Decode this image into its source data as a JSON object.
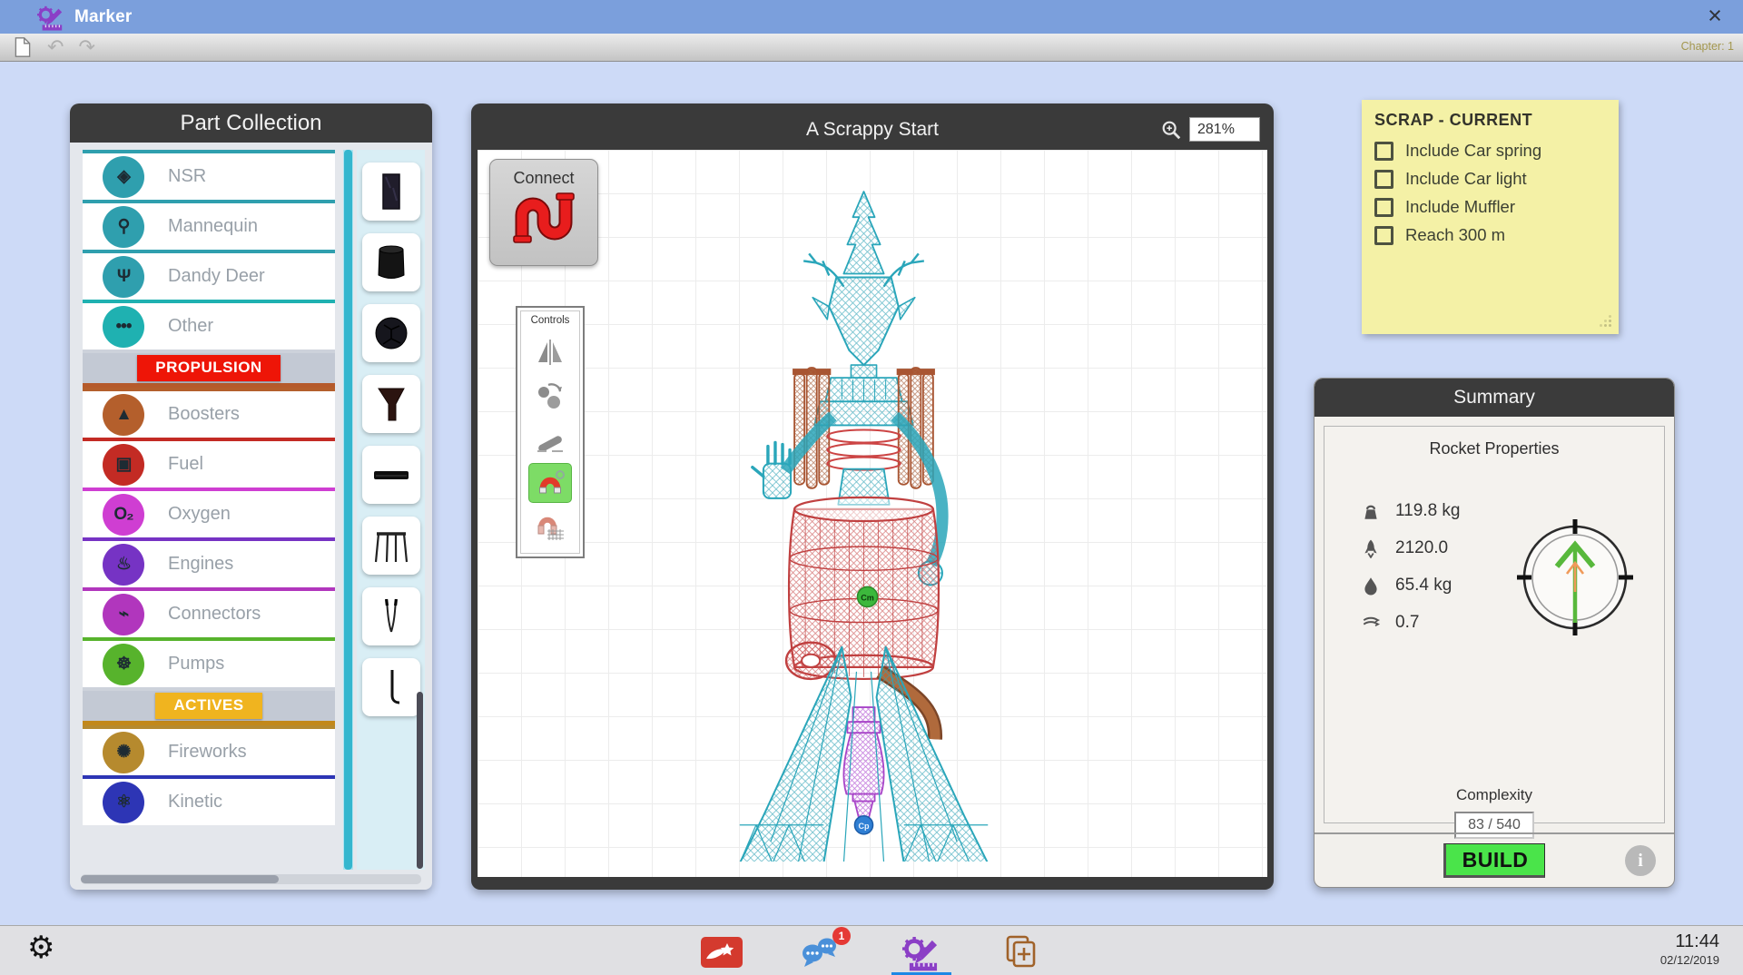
{
  "theme": {
    "accent_blue": "#7b9fdc",
    "desktop": "#cddaf7",
    "panel_dark": "#3b3b3b",
    "note_yellow": "#f4f1a6",
    "build_green": "#4ae44a",
    "badge_red": "#e53935",
    "active_blue": "#1e88e5"
  },
  "window": {
    "app_title": "Marker",
    "close_glyph": "×",
    "chapter": "Chapter: 1",
    "undo_glyph": "↶",
    "redo_glyph": "↷"
  },
  "part_collection": {
    "title": "Part Collection",
    "categories": [
      {
        "type": "part",
        "label": "NSR",
        "icon_name": "cube-icon",
        "glyph": "◈",
        "color": "#2f9fae"
      },
      {
        "type": "part",
        "label": "Mannequin",
        "icon_name": "mannequin-icon",
        "glyph": "⚲",
        "color": "#2f9fae"
      },
      {
        "type": "part",
        "label": "Dandy Deer",
        "icon_name": "deer-icon",
        "glyph": "Ψ",
        "color": "#2f9fae"
      },
      {
        "type": "part",
        "label": "Other",
        "icon_name": "dots-icon",
        "glyph": "•••",
        "color": "#1fb1b1"
      },
      {
        "type": "section",
        "label": "PROPULSION",
        "color": "#ee1507",
        "underline": "#b55a2b"
      },
      {
        "type": "part",
        "label": "Boosters",
        "icon_name": "booster-icon",
        "glyph": "▲",
        "color": "#b45f2c"
      },
      {
        "type": "part",
        "label": "Fuel",
        "icon_name": "fuel-can-icon",
        "glyph": "▣",
        "color": "#c32b24"
      },
      {
        "type": "part",
        "label": "Oxygen",
        "icon_name": "oxygen-icon",
        "glyph": "O₂",
        "color": "#cf3ed2"
      },
      {
        "type": "part",
        "label": "Engines",
        "icon_name": "engine-icon",
        "glyph": "♨",
        "color": "#7633c4"
      },
      {
        "type": "part",
        "label": "Connectors",
        "icon_name": "connector-icon",
        "glyph": "⌁",
        "color": "#b136bd"
      },
      {
        "type": "part",
        "label": "Pumps",
        "icon_name": "pump-icon",
        "glyph": "☸",
        "color": "#57b32c"
      },
      {
        "type": "section",
        "label": "ACTIVES",
        "color": "#f0b41f",
        "underline": "#c2881a"
      },
      {
        "type": "part",
        "label": "Fireworks",
        "icon_name": "fireworks-icon",
        "glyph": "✺",
        "color": "#b68a2e"
      },
      {
        "type": "part",
        "label": "Kinetic",
        "icon_name": "kinetic-icon",
        "glyph": "⚛",
        "color": "#2d35b5"
      }
    ],
    "thumbnails": [
      {
        "name": "panel-part",
        "icon": "ic-part-panel"
      },
      {
        "name": "barrel-part",
        "icon": "ic-part-barrel"
      },
      {
        "name": "ball-part",
        "icon": "ic-part-ball"
      },
      {
        "name": "funnel-part",
        "icon": "ic-part-funnel"
      },
      {
        "name": "bar-part",
        "icon": "ic-part-bar"
      },
      {
        "name": "frame-part",
        "icon": "ic-part-frame"
      },
      {
        "name": "tweezer-part",
        "icon": "ic-part-tweezer"
      },
      {
        "name": "stick-part",
        "icon": "ic-part-stick"
      }
    ]
  },
  "canvas": {
    "title": "A Scrappy Start",
    "zoom_value": "281%",
    "connect_label": "Connect",
    "controls": {
      "title": "Controls",
      "items": [
        {
          "name": "mirror-tool",
          "icon": "ic-flip"
        },
        {
          "name": "rotate-tool",
          "icon": "ic-rotate"
        },
        {
          "name": "incline-tool",
          "icon": "ic-incline"
        },
        {
          "name": "magnet-tool",
          "icon": "ic-magnet",
          "selected": true
        },
        {
          "name": "magnet-grid-tool",
          "icon": "ic-magnet-grid"
        }
      ]
    },
    "figure": {
      "cm_label": "Cm",
      "cp_label": "Cp"
    }
  },
  "scrap_note": {
    "title": "SCRAP  - CURRENT",
    "items": [
      "Include Car spring",
      "Include Car light",
      "Include Muffler",
      "Reach 300 m"
    ]
  },
  "summary": {
    "title": "Summary",
    "subtitle": "Rocket Properties",
    "properties": [
      {
        "name": "mass",
        "icon": "ic-mass",
        "value": "119.8 kg"
      },
      {
        "name": "thrust",
        "icon": "ic-thrust",
        "value": "2120.0"
      },
      {
        "name": "fuel-mass",
        "icon": "ic-fuel",
        "value": "65.4 kg"
      },
      {
        "name": "drag",
        "icon": "ic-drag",
        "value": "0.7"
      }
    ],
    "complexity_label": "Complexity",
    "complexity_value": "83 / 540",
    "build_label": "BUILD",
    "info_glyph": "i"
  },
  "taskbar": {
    "settings_glyph": "⚙",
    "apps": [
      {
        "name": "chili-app",
        "icon": "ic-chili"
      },
      {
        "name": "chat-app",
        "icon": "ic-chat",
        "badge": "1"
      },
      {
        "name": "marker-app",
        "icon": "ic-marker",
        "active": true
      },
      {
        "name": "cards-app",
        "icon": "ic-cards"
      }
    ],
    "time": "11:44",
    "date": "02/12/2019"
  }
}
